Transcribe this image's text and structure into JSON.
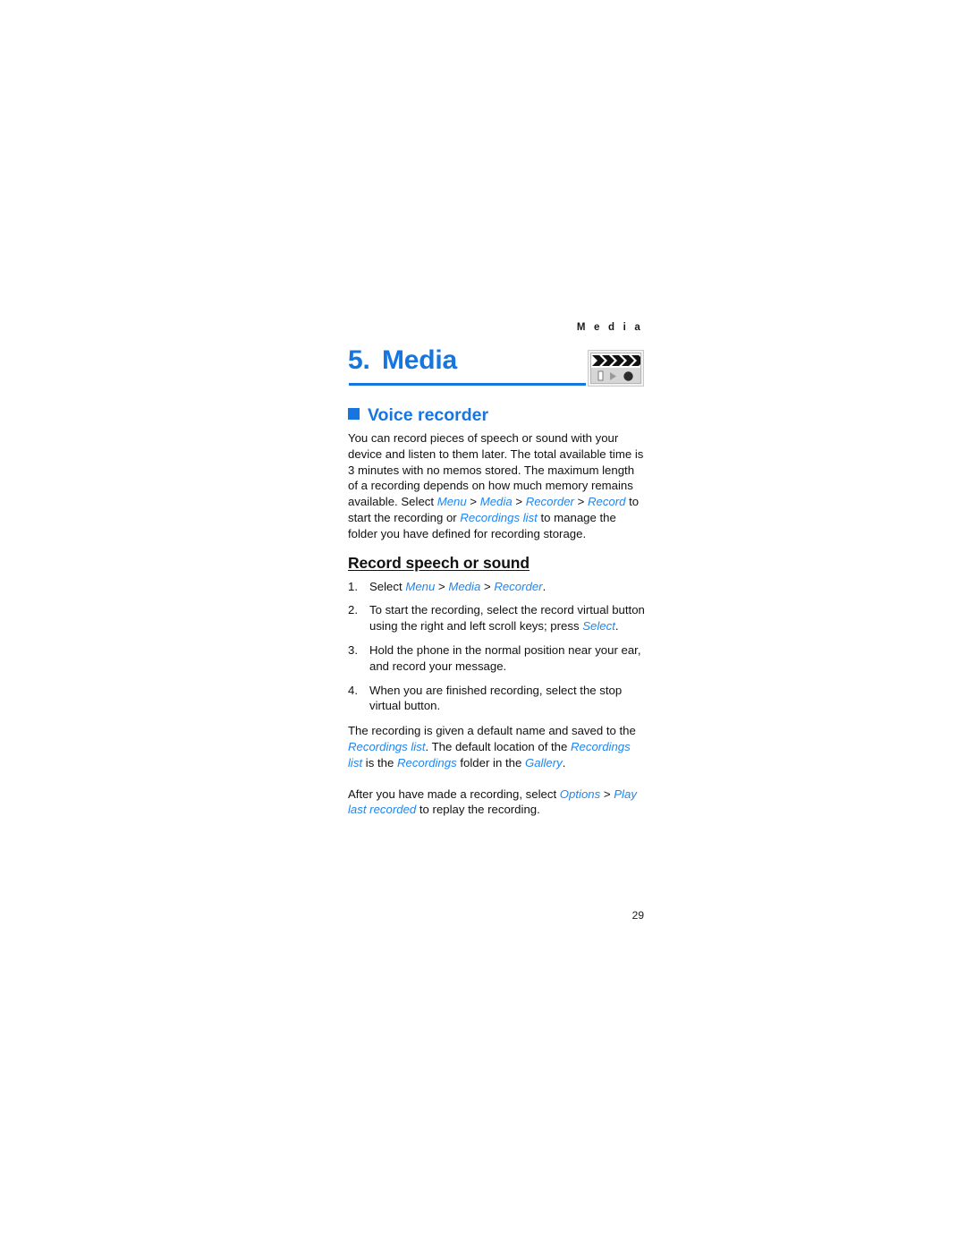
{
  "document": {
    "running_head": "M e d i a",
    "folio": "29",
    "accent_color": "#1775e0",
    "link_color": "#1f86ef"
  },
  "chapter": {
    "number": "5.",
    "title": "Media",
    "icon": "media-clapperboard-icon"
  },
  "section": {
    "bullet": "blue-square-bullet",
    "title": "Voice recorder"
  },
  "intro": {
    "part1": "You can record pieces of speech or sound with your device and listen to them later. The total available time is 3 minutes with no memos stored. The maximum length of a recording depends on how much memory remains available. Select ",
    "menu": "Menu",
    "sep1": " > ",
    "media": "Media",
    "sep2": " > ",
    "recorder": "Recorder",
    "sep3": " > ",
    "record": "Record",
    "part2": " to start the recording or ",
    "recordings_list": "Recordings list",
    "part3": " to manage the folder you have defined for recording storage."
  },
  "subsection": {
    "title": "Record speech or sound",
    "steps": [
      {
        "num": "1.",
        "pre": "Select ",
        "ui1": "Menu",
        "sep1": " > ",
        "ui2": "Media",
        "sep2": " > ",
        "ui3": "Recorder",
        "post": "."
      },
      {
        "num": "2.",
        "pre": "To start the recording, select the record virtual button using the right and left scroll keys; press ",
        "ui1": "Select",
        "post": "."
      },
      {
        "num": "3.",
        "pre": "Hold the phone in the normal position near your ear, and record your message.",
        "post": ""
      },
      {
        "num": "4.",
        "pre": "When you are finished recording, select the stop virtual button.",
        "post": ""
      }
    ]
  },
  "outro1": {
    "part1": "The recording is given a default name and saved to the ",
    "ui1": "Recordings list",
    "part2": ". The default location of the ",
    "ui2": "Recordings list",
    "part3": " is the ",
    "ui3": "Recordings",
    "part4": " folder in the ",
    "ui4": "Gallery",
    "part5": "."
  },
  "outro2": {
    "part1": "After you have made a recording, select ",
    "ui1": "Options",
    "sep1": " > ",
    "ui2": "Play last recorded",
    "part2": " to replay the recording."
  }
}
